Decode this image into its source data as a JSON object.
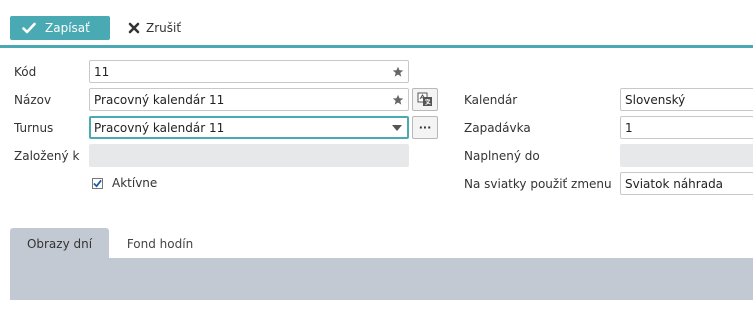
{
  "toolbar": {
    "save_label": "Zapísať",
    "cancel_label": "Zrušiť"
  },
  "form": {
    "kod": {
      "label": "Kód",
      "value": "11"
    },
    "nazov": {
      "label": "Názov",
      "value": "Pracovný kalendár 11"
    },
    "turnus": {
      "label": "Turnus",
      "value": "Pracovný kalendár 11",
      "more_label": "···"
    },
    "zalozeny": {
      "label": "Založený k",
      "value": ""
    },
    "aktivne": {
      "label": "Aktívne",
      "checked": true
    },
    "kalendar": {
      "label": "Kalendár",
      "value": "Slovenský"
    },
    "zapadavka": {
      "label": "Zapadávka",
      "value": "1"
    },
    "naplneny": {
      "label": "Naplnený do",
      "value": ""
    },
    "sviatky": {
      "label": "Na sviatky použiť zmenu",
      "value": "Sviatok náhrada"
    }
  },
  "tabs": [
    {
      "label": "Obrazy dní",
      "active": true
    },
    {
      "label": "Fond hodín",
      "active": false
    }
  ],
  "colors": {
    "accent": "#4aaab3",
    "readonly_bg": "#e6e8ea",
    "tab_bg": "#c2c9d2"
  },
  "icons": {
    "save": "check-icon",
    "cancel": "x-icon",
    "required": "star-icon",
    "translate": "translate-icon",
    "dropdown": "chevron-down-icon",
    "checkbox": "checkmark-icon"
  }
}
